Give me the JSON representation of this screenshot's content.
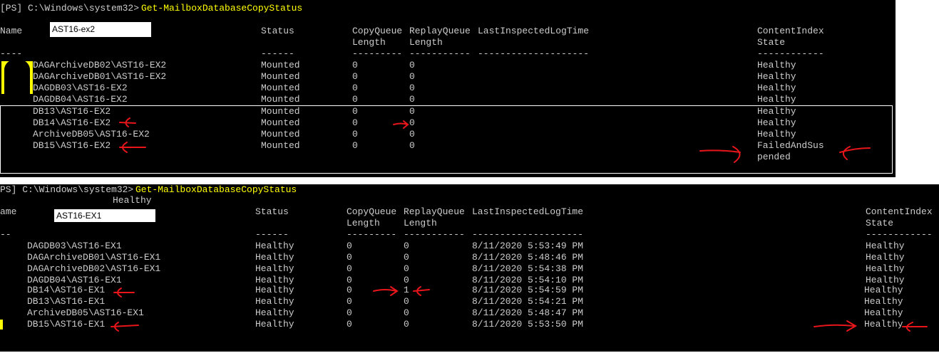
{
  "colors": {
    "background": "#000000",
    "text": "#cccccc",
    "prompt_cmd": "#ffff00",
    "annotation": "#e8161b"
  },
  "top": {
    "prompt": "[PS] C:\\Windows\\system32>",
    "command": "Get-MailboxDatabaseCopyStatus",
    "name_hdr": "Name",
    "server_box": "AST16-ex2",
    "status_hdr": "Status",
    "cq_hdr1": "CopyQueue",
    "cq_hdr2": "Length",
    "rq_hdr1": "ReplayQueue",
    "rq_hdr2": "Length",
    "lil_hdr": "LastInspectedLogTime",
    "ci_hdr1": "ContentIndex",
    "ci_hdr2": "State",
    "sep_name": "----",
    "sep_status": "------",
    "sep_cq": "---------",
    "sep_rq": "-----------",
    "sep_lil": "--------------------",
    "sep_ci": "------------",
    "rows": [
      {
        "name": "DAGArchiveDB02\\AST16-EX2",
        "status": "Mounted",
        "cq": "0",
        "rq": "0",
        "lil": "",
        "ci": "Healthy"
      },
      {
        "name": "DAGArchiveDB01\\AST16-EX2",
        "status": "Mounted",
        "cq": "0",
        "rq": "0",
        "lil": "",
        "ci": "Healthy"
      },
      {
        "name": "DAGDB03\\AST16-EX2",
        "status": "Mounted",
        "cq": "0",
        "rq": "0",
        "lil": "",
        "ci": "Healthy"
      },
      {
        "name": "DAGDB04\\AST16-EX2",
        "status": "Mounted",
        "cq": "0",
        "rq": "0",
        "lil": "",
        "ci": "Healthy"
      },
      {
        "name": "DB13\\AST16-EX2",
        "status": "Mounted",
        "cq": "0",
        "rq": "0",
        "lil": "",
        "ci": "Healthy"
      },
      {
        "name": "DB14\\AST16-EX2",
        "status": "Mounted",
        "cq": "0",
        "rq": "0",
        "lil": "",
        "ci": "Healthy"
      },
      {
        "name": "ArchiveDB05\\AST16-EX2",
        "status": "Mounted",
        "cq": "0",
        "rq": "0",
        "lil": "",
        "ci": "Healthy"
      },
      {
        "name": "DB15\\AST16-EX2",
        "status": "Mounted",
        "cq": "0",
        "rq": "0",
        "lil": "",
        "ci": "FailedAndSus"
      }
    ],
    "ci_wrap": "pended"
  },
  "bottom": {
    "prompt": "PS] C:\\Windows\\system32>",
    "command": "Get-MailboxDatabaseCopyStatus",
    "stray_text": "Healthy",
    "name_hdr": "ame",
    "server_box": "AST16-EX1",
    "status_hdr": "Status",
    "cq_hdr1": "CopyQueue",
    "cq_hdr2": "Length",
    "rq_hdr1": "ReplayQueue",
    "rq_hdr2": "Length",
    "lil_hdr": "LastInspectedLogTime",
    "ci_hdr1": "ContentIndex",
    "ci_hdr2": "State",
    "sep_name": "--",
    "sep_status": "------",
    "sep_cq": "---------",
    "sep_rq": "-----------",
    "sep_lil": "--------------------",
    "sep_ci": "------------",
    "rows": [
      {
        "name": "DAGDB03\\AST16-EX1",
        "status": "Healthy",
        "cq": "0",
        "rq": "0",
        "lil": "8/11/2020 5:53:49 PM",
        "ci": "Healthy"
      },
      {
        "name": "DAGArchiveDB01\\AST16-EX1",
        "status": "Healthy",
        "cq": "0",
        "rq": "0",
        "lil": "8/11/2020 5:48:46 PM",
        "ci": "Healthy"
      },
      {
        "name": "DAGArchiveDB02\\AST16-EX1",
        "status": "Healthy",
        "cq": "0",
        "rq": "0",
        "lil": "8/11/2020 5:54:38 PM",
        "ci": "Healthy"
      },
      {
        "name": "DAGDB04\\AST16-EX1",
        "status": "Healthy",
        "cq": "0",
        "rq": "0",
        "lil": "8/11/2020 5:54:10 PM",
        "ci": "Healthy"
      },
      {
        "name": "DB14\\AST16-EX1",
        "status": "Healthy",
        "cq": "0",
        "rq": "1",
        "lil": "8/11/2020 5:54:59 PM",
        "ci": "Healthy"
      },
      {
        "name": "DB13\\AST16-EX1",
        "status": "Healthy",
        "cq": "0",
        "rq": "0",
        "lil": "8/11/2020 5:54:21 PM",
        "ci": "Healthy"
      },
      {
        "name": "ArchiveDB05\\AST16-EX1",
        "status": "Healthy",
        "cq": "0",
        "rq": "0",
        "lil": "8/11/2020 5:48:47 PM",
        "ci": "Healthy"
      },
      {
        "name": "DB15\\AST16-EX1",
        "status": "Healthy",
        "cq": "0",
        "rq": "0",
        "lil": "8/11/2020 5:53:50 PM",
        "ci": "Healthy"
      }
    ]
  }
}
